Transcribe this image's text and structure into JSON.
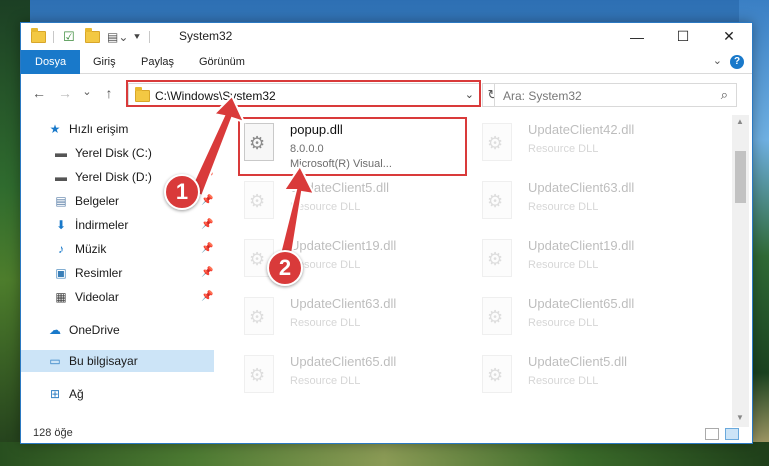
{
  "window": {
    "title": "System32",
    "controls": {
      "minimize": "—",
      "maximize": "☐",
      "close": "✕"
    }
  },
  "ribbon": {
    "tabs": [
      "Dosya",
      "Giriş",
      "Paylaş",
      "Görünüm"
    ],
    "help": "?"
  },
  "navigation": {
    "back": "←",
    "forward": "→",
    "recent": "⌄",
    "up": "↑",
    "address_path": "C:\\Windows\\System32",
    "refresh": "↻",
    "search_placeholder": "Ara: System32"
  },
  "sidebar": {
    "quick_access": "Hızlı erişim",
    "items": [
      {
        "label": "Yerel Disk (C:)",
        "icon": "drive-icon",
        "pinned": false
      },
      {
        "label": "Yerel Disk (D:)",
        "icon": "drive-icon",
        "pinned": true
      },
      {
        "label": "Belgeler",
        "icon": "documents-icon",
        "pinned": true
      },
      {
        "label": "İndirmeler",
        "icon": "downloads-icon",
        "pinned": true
      },
      {
        "label": "Müzik",
        "icon": "music-icon",
        "pinned": true
      },
      {
        "label": "Resimler",
        "icon": "pictures-icon",
        "pinned": true
      },
      {
        "label": "Videolar",
        "icon": "videos-icon",
        "pinned": true
      }
    ],
    "onedrive": "OneDrive",
    "this_pc": "Bu bilgisayar",
    "network": "Ağ"
  },
  "files": [
    {
      "name": "popup.dll",
      "line2": "8.0.0.0",
      "line3": "Microsoft(R) Visual...",
      "highlighted": true
    },
    {
      "name": "UpdateClient42.dll",
      "line2": "Resource DLL"
    },
    {
      "name": "UpdateClient5.dll",
      "line2": "Resource DLL"
    },
    {
      "name": "UpdateClient63.dll",
      "line2": "Resource DLL"
    },
    {
      "name": "UpdateClient19.dll",
      "line2": "Resource DLL"
    },
    {
      "name": "UpdateClient19.dll",
      "line2": "Resource DLL"
    },
    {
      "name": "UpdateClient63.dll",
      "line2": "Resource DLL"
    },
    {
      "name": "UpdateClient65.dll",
      "line2": "Resource DLL"
    },
    {
      "name": "UpdateClient65.dll",
      "line2": "Resource DLL"
    },
    {
      "name": "UpdateClient5.dll",
      "line2": "Resource DLL"
    }
  ],
  "status": {
    "item_count": "128 öğe"
  },
  "callouts": [
    "1",
    "2"
  ],
  "colors": {
    "accent": "#1979ca",
    "highlight": "#d93a3a",
    "selected": "#cce4f7"
  }
}
